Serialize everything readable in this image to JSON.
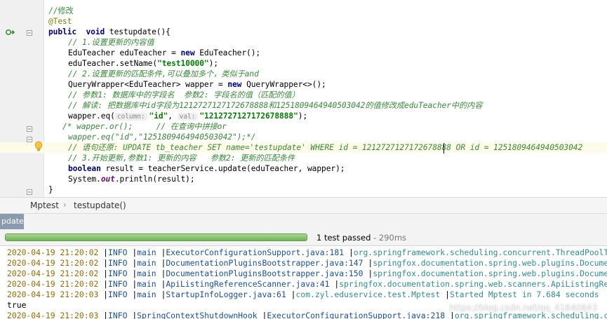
{
  "code_lines": [
    {
      "segs": [
        {
          "t": "//修改",
          "c": "t-green"
        }
      ]
    },
    {
      "segs": [
        {
          "t": "@Test",
          "c": "t-anno"
        }
      ]
    },
    {
      "segs": [
        {
          "t": "public  void ",
          "c": "t-kw"
        },
        {
          "t": "testupdate(){",
          "c": "t-plain"
        }
      ]
    },
    {
      "segs": [
        {
          "t": "// 1.设置更新的内容值",
          "c": "t-green t-italic"
        }
      ]
    },
    {
      "segs": [
        {
          "t": "EduTeacher eduTeacher = ",
          "c": "t-plain"
        },
        {
          "t": "new ",
          "c": "t-kw"
        },
        {
          "t": "EduTeacher();",
          "c": "t-plain"
        }
      ]
    },
    {
      "segs": [
        {
          "t": "eduTeacher.setName(",
          "c": "t-plain"
        },
        {
          "t": "\"test10000\"",
          "c": "t-str"
        },
        {
          "t": ");",
          "c": "t-plain"
        }
      ]
    },
    {
      "segs": [
        {
          "t": "// 2.设置更新的匹配条件,可以叠加多个，类似于and",
          "c": "t-green t-italic"
        }
      ]
    },
    {
      "segs": [
        {
          "t": "QueryWrapper<EduTeacher> wapper = ",
          "c": "t-plain"
        },
        {
          "t": "new ",
          "c": "t-kw"
        },
        {
          "t": "QueryWrapper<>();",
          "c": "t-plain"
        }
      ]
    },
    {
      "segs": [
        {
          "t": "// 参数1: 数据库中的字段名  参数2: 字段名的值（匹配的值）",
          "c": "t-green t-italic"
        }
      ]
    },
    {
      "segs": [
        {
          "t": "// 解读: 把数据库中id字段为1212727127172678888和1251809464940503042的值修改成eduTeacher中的内容",
          "c": "t-green t-italic"
        }
      ]
    },
    {
      "segs": [
        {
          "t": "wapper.eq(",
          "c": "t-plain"
        },
        {
          "t": "column:",
          "c": "t-hint"
        },
        {
          "t": "\"id\"",
          "c": "t-str"
        },
        {
          "t": ", ",
          "c": "t-plain"
        },
        {
          "t": "val:",
          "c": "t-hint"
        },
        {
          "t": "\"1212727127172678888\"",
          "c": "t-str"
        },
        {
          "t": ");",
          "c": "t-plain"
        }
      ]
    },
    {
      "segs": [
        {
          "t": "/* wapper.or();     // 在查询中拼接or",
          "c": "t-green t-italic"
        }
      ]
    },
    {
      "segs": [
        {
          "t": "wapper.eq(\"id\",\"1251809464940503042\");*/",
          "c": "t-green t-italic"
        }
      ]
    },
    {
      "segs": [
        {
          "t": "// 语句还原: UPDATE tb_teacher SET name='testupdate' WHERE id = 1212727127172678888 OR id = 1251809464940503042",
          "c": "t-green t-italic"
        }
      ]
    },
    {
      "segs": [
        {
          "t": "// 3.开始更新,参数1: 更新的内容   参数2: 更新的匹配条件",
          "c": "t-green t-italic"
        }
      ]
    },
    {
      "segs": [
        {
          "t": "boolean ",
          "c": "t-kw"
        },
        {
          "t": "result = teacherService.update(eduTeacher, wapper);",
          "c": "t-plain"
        }
      ]
    },
    {
      "segs": [
        {
          "t": "System.",
          "c": "t-plain"
        },
        {
          "t": "out",
          "c": "t-static"
        },
        {
          "t": ".println(result);",
          "c": "t-plain"
        }
      ]
    },
    {
      "segs": [
        {
          "t": "}",
          "c": "t-plain"
        }
      ]
    }
  ],
  "breadcrumb": {
    "class_name": "Mptest",
    "separator": "›",
    "method_name": "testupdate()"
  },
  "run_tab": {
    "label": "pdate"
  },
  "test_result": {
    "status": "1 test passed",
    "duration": " - 290ms",
    "progress": 1.0
  },
  "console_lines": [
    {
      "segs": [
        {
          "t": "2020-04-19 21:20:02 ",
          "c": "log-date"
        },
        {
          "t": "|",
          "c": "log-pipe"
        },
        {
          "t": "INFO ",
          "c": "log-level"
        },
        {
          "t": "|",
          "c": "log-pipe"
        },
        {
          "t": "main ",
          "c": "log-thread"
        },
        {
          "t": "|",
          "c": "log-pipe"
        },
        {
          "t": "ExecutorConfigurationSupport.java:181 ",
          "c": "log-src"
        },
        {
          "t": "|",
          "c": "log-pipe"
        },
        {
          "t": "org.springframework.scheduling.concurrent.ThreadPoolTaskExecutor",
          "c": "log-cat"
        }
      ]
    },
    {
      "segs": [
        {
          "t": "2020-04-19 21:20:02 ",
          "c": "log-date"
        },
        {
          "t": "|",
          "c": "log-pipe"
        },
        {
          "t": "INFO ",
          "c": "log-level"
        },
        {
          "t": "|",
          "c": "log-pipe"
        },
        {
          "t": "main ",
          "c": "log-thread"
        },
        {
          "t": "|",
          "c": "log-pipe"
        },
        {
          "t": "DocumentationPluginsBootstrapper.java:147 ",
          "c": "log-src"
        },
        {
          "t": "|",
          "c": "log-pipe"
        },
        {
          "t": "springfox.documentation.spring.web.plugins.DocumentationPluginsBootstrapper",
          "c": "log-cat"
        }
      ]
    },
    {
      "segs": [
        {
          "t": "2020-04-19 21:20:02 ",
          "c": "log-date"
        },
        {
          "t": "|",
          "c": "log-pipe"
        },
        {
          "t": "INFO ",
          "c": "log-level"
        },
        {
          "t": "|",
          "c": "log-pipe"
        },
        {
          "t": "main ",
          "c": "log-thread"
        },
        {
          "t": "|",
          "c": "log-pipe"
        },
        {
          "t": "DocumentationPluginsBootstrapper.java:150 ",
          "c": "log-src"
        },
        {
          "t": "|",
          "c": "log-pipe"
        },
        {
          "t": "springfox.documentation.spring.web.plugins.DocumentationPluginsBootstrapper",
          "c": "log-cat"
        }
      ]
    },
    {
      "segs": [
        {
          "t": "2020-04-19 21:20:02 ",
          "c": "log-date"
        },
        {
          "t": "|",
          "c": "log-pipe"
        },
        {
          "t": "INFO ",
          "c": "log-level"
        },
        {
          "t": "|",
          "c": "log-pipe"
        },
        {
          "t": "main ",
          "c": "log-thread"
        },
        {
          "t": "|",
          "c": "log-pipe"
        },
        {
          "t": "ApiListingReferenceScanner.java:41 ",
          "c": "log-src"
        },
        {
          "t": "|",
          "c": "log-pipe"
        },
        {
          "t": "springfox.documentation.spring.web.scanners.ApiListingReferenceScanner",
          "c": "log-cat"
        }
      ]
    },
    {
      "segs": [
        {
          "t": "2020-04-19 21:20:03 ",
          "c": "log-date"
        },
        {
          "t": "|",
          "c": "log-pipe"
        },
        {
          "t": "INFO ",
          "c": "log-level"
        },
        {
          "t": "|",
          "c": "log-pipe"
        },
        {
          "t": "main ",
          "c": "log-thread"
        },
        {
          "t": "|",
          "c": "log-pipe"
        },
        {
          "t": "StartupInfoLogger.java:61 ",
          "c": "log-src"
        },
        {
          "t": "|",
          "c": "log-pipe"
        },
        {
          "t": "com.zyl.eduservice.test.Mptest ",
          "c": "log-cat"
        },
        {
          "t": "|",
          "c": "log-pipe"
        },
        {
          "t": "Started Mptest in 7.684 seconds",
          "c": "log-msg"
        }
      ]
    },
    {
      "segs": [
        {
          "t": "true",
          "c": "log-pipe"
        }
      ]
    },
    {
      "segs": [
        {
          "t": "2020-04-19 21:20:03 ",
          "c": "log-date"
        },
        {
          "t": "|",
          "c": "log-pipe"
        },
        {
          "t": "INFO ",
          "c": "log-level"
        },
        {
          "t": "|",
          "c": "log-pipe"
        },
        {
          "t": "SpringContextShutdownHook ",
          "c": "log-thread"
        },
        {
          "t": "|",
          "c": "log-pipe"
        },
        {
          "t": "ExecutorConfigurationSupport.java:218 ",
          "c": "log-src"
        },
        {
          "t": "|",
          "c": "log-pipe"
        },
        {
          "t": "org.springframework.scheduling.concurrent.ThreadPoolTaskExecutor",
          "c": "log-cat"
        }
      ]
    }
  ],
  "watermark": "https://blog.csdn.net/qq_41840843"
}
